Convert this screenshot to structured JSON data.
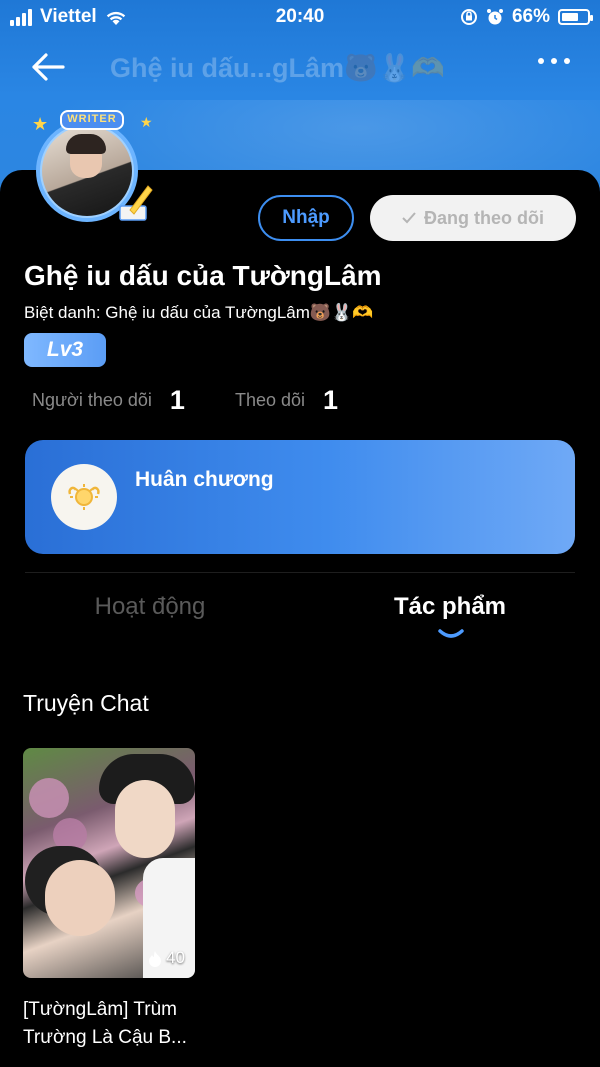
{
  "status_bar": {
    "carrier": "Viettel",
    "time": "20:40",
    "battery_percent": "66%",
    "battery_level": 0.66
  },
  "nav": {
    "title": "Ghệ iu dấu...gLâm🐻🐰🫶"
  },
  "profile": {
    "writer_badge": "WRITER",
    "name": "Ghệ iu dấu của TườngLâm",
    "nickname": "Biệt danh: Ghệ iu dấu của TườngLâm🐻🐰🫶",
    "level": "Lv3"
  },
  "actions": {
    "import_label": "Nhập",
    "following_label": "Đang theo dõi"
  },
  "stats": {
    "followers_label": "Người theo dõi",
    "followers_value": "1",
    "following_label": "Theo dõi",
    "following_value": "1"
  },
  "medal": {
    "title": "Huân chương"
  },
  "tabs": [
    {
      "label": "Hoạt động",
      "active": false
    },
    {
      "label": "Tác phẩm",
      "active": true
    }
  ],
  "section": {
    "title": "Truyện Chat"
  },
  "stories": [
    {
      "title_line1": "[TườngLâm] Trùm",
      "title_line2": "Trường Là Cậu B...",
      "views": "40"
    }
  ],
  "colors": {
    "header_blue": "#2a86e4",
    "accent_blue": "#3d8ef0",
    "background": "#000000",
    "muted_text": "#8a8a8a"
  },
  "icons": [
    "back-arrow-icon",
    "more-icon",
    "signal-icon",
    "wifi-icon",
    "lock-rotation-icon",
    "alarm-icon",
    "battery-icon",
    "checkmark-icon",
    "medal-icon",
    "fire-icon"
  ]
}
